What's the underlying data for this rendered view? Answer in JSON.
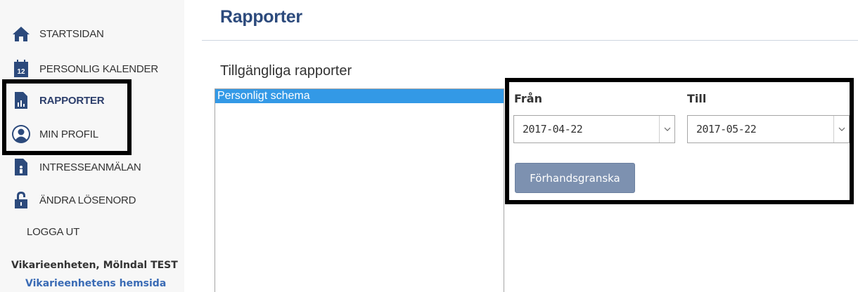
{
  "sidebar": {
    "items": [
      {
        "label": "STARTSIDAN",
        "icon": "home-icon"
      },
      {
        "label": "PERSONLIG KALENDER",
        "icon": "calendar-icon"
      },
      {
        "label": "RAPPORTER",
        "icon": "report-icon",
        "active": true
      },
      {
        "label": "MIN PROFIL",
        "icon": "user-profile-icon"
      },
      {
        "label": "INTRESSEANMÄLAN",
        "icon": "interest-document-icon"
      },
      {
        "label": "ÄNDRA LÖSENORD",
        "icon": "padlock-icon"
      },
      {
        "label": "LOGGA UT"
      }
    ],
    "org_name": "Vikarieenheten, Mölndal TEST",
    "org_link": "Vikarieenhetens hemsida"
  },
  "main": {
    "title": "Rapporter",
    "section_title": "Tillgängliga rapporter",
    "reports": [
      "Personligt schema"
    ],
    "from_label": "Från",
    "to_label": "Till",
    "from_value": "2017-04-22",
    "to_value": "2017-05-22",
    "preview_button": "Förhandsgranska"
  },
  "colors": {
    "accent": "#2c4a7c",
    "selected_row": "#3399e6",
    "button": "#7d91b0",
    "link": "#3a6bb5"
  }
}
